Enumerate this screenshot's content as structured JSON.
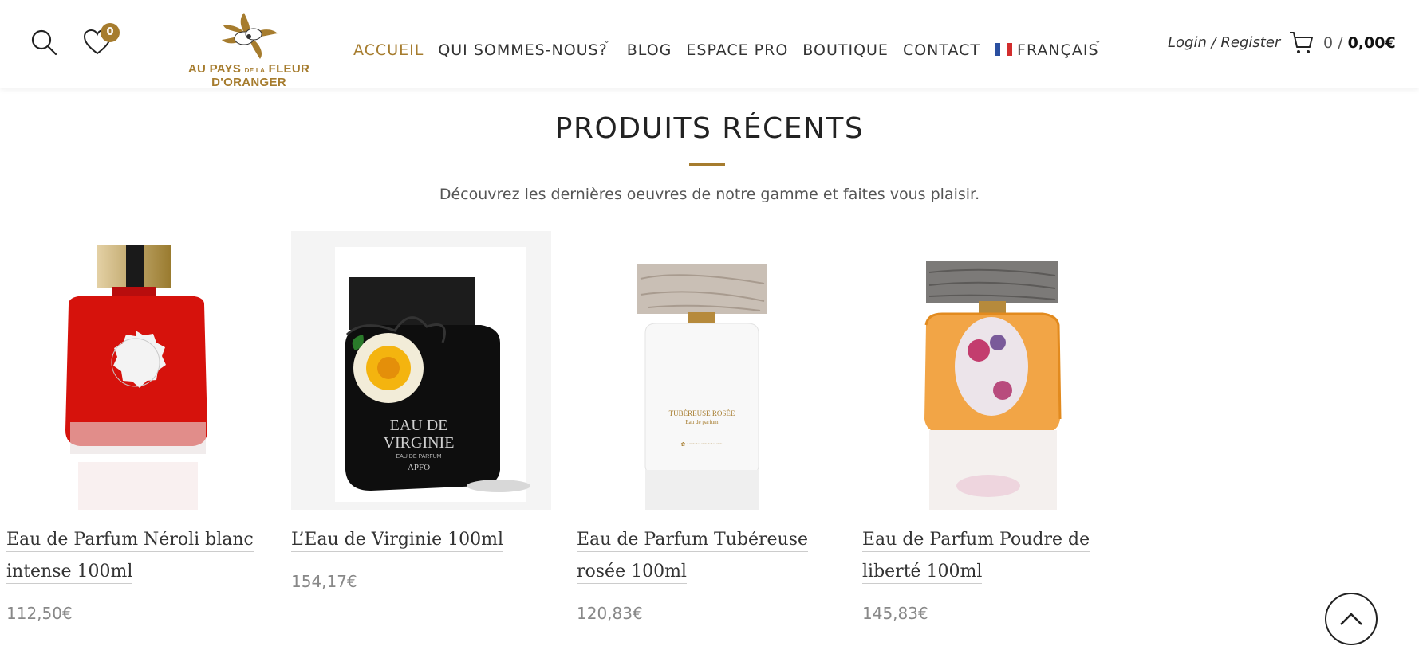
{
  "header": {
    "wishlist_count": "0",
    "logo": {
      "line_main_1": "AU PAYS",
      "line_small": "DE LA",
      "line_main_2": "FLEUR D'ORANGER"
    },
    "nav": [
      {
        "label": "ACCUEIL",
        "active": true
      },
      {
        "label": "QUI SOMMES-NOUS?",
        "dropdown": true
      },
      {
        "label": "BLOG"
      },
      {
        "label": "ESPACE PRO"
      },
      {
        "label": "BOUTIQUE"
      },
      {
        "label": "CONTACT"
      },
      {
        "label": "FRANÇAIS",
        "dropdown": true,
        "flag": "fr-flag-icon"
      }
    ],
    "login_label": "Login / Register",
    "cart": {
      "count": "0",
      "separator": " / ",
      "total": "0,00€"
    }
  },
  "section": {
    "title": "PRODUITS RÉCENTS",
    "subtitle": "Découvrez les dernières oeuvres de notre gamme et faites vous plaisir."
  },
  "products": [
    {
      "name": "Eau de Parfum Néroli blanc intense 100ml",
      "price": "112,50€",
      "image": "neroli-bottle-image"
    },
    {
      "name": "L’Eau de Virginie 100ml",
      "price": "154,17€",
      "image": "virginie-bottle-image",
      "bottle_text_1": "EAU DE",
      "bottle_text_2": "VIRGINIE",
      "bottle_text_3": "EAU DE PARFUM",
      "bottle_text_4": "APFO"
    },
    {
      "name": "Eau de Parfum Tubéreuse rosée 100ml",
      "price": "120,83€",
      "image": "tubereuse-bottle-image",
      "bottle_text_1": "TUBÉREUSE ROSÉE",
      "bottle_text_2": "Eau de parfum"
    },
    {
      "name": "Eau de Parfum Poudre de liberté 100ml",
      "price": "145,83€",
      "image": "poudre-bottle-image"
    }
  ],
  "colors": {
    "accent": "#a67c2e",
    "text": "#333333",
    "price": "#888888"
  }
}
